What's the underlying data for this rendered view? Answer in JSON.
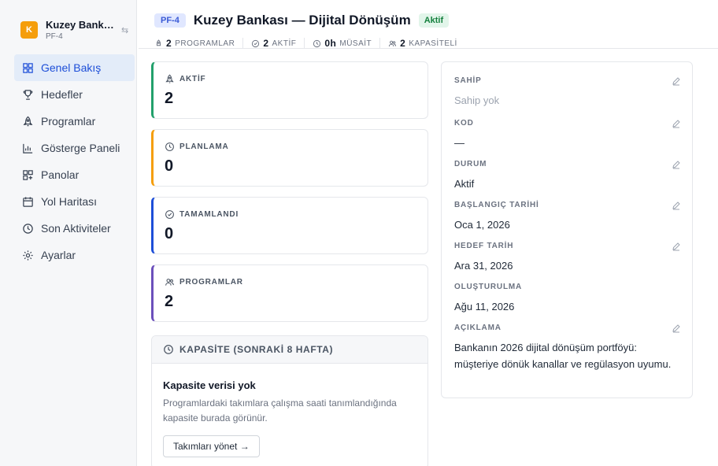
{
  "workspace": {
    "avatar_letter": "K",
    "name": "Kuzey Bankası",
    "key": "PF-4",
    "switch_icon": "⇆"
  },
  "sidebar": {
    "items": [
      {
        "label": "Genel Bakış",
        "icon": "grid-icon",
        "active": true
      },
      {
        "label": "Hedefler",
        "icon": "trophy-icon"
      },
      {
        "label": "Programlar",
        "icon": "rocket-icon"
      },
      {
        "label": "Gösterge Paneli",
        "icon": "bar-chart-icon"
      },
      {
        "label": "Panolar",
        "icon": "board-icon"
      },
      {
        "label": "Yol Haritası",
        "icon": "calendar-icon"
      },
      {
        "label": "Son Aktiviteler",
        "icon": "clock-icon"
      },
      {
        "label": "Ayarlar",
        "icon": "gear-icon"
      }
    ]
  },
  "header": {
    "key": "PF-4",
    "title": "Kuzey Bankası — Dijital Dönüşüm",
    "status": "Aktif",
    "stats": [
      {
        "value": "2",
        "label": "PROGRAMLAR",
        "icon": "rocket-icon"
      },
      {
        "value": "2",
        "label": "AKTİF",
        "icon": "check-circle-icon"
      },
      {
        "value": "0h",
        "label": "MÜSAİT",
        "icon": "clock-icon"
      },
      {
        "value": "2",
        "label": "KAPASİTELİ",
        "icon": "users-icon"
      }
    ]
  },
  "kpis": [
    {
      "label": "AKTİF",
      "value": "2",
      "icon": "rocket-icon",
      "color": "#22a06b"
    },
    {
      "label": "PLANLAMA",
      "value": "0",
      "icon": "clock-icon",
      "color": "#f59e0b"
    },
    {
      "label": "TAMAMLANDI",
      "value": "0",
      "icon": "check-circle-icon",
      "color": "#1d4ed8"
    },
    {
      "label": "PROGRAMLAR",
      "value": "2",
      "icon": "users-icon",
      "color": "#6b4fbb"
    }
  ],
  "capacity": {
    "header": "KAPASİTE (SONRAKİ 8 HAFTA)",
    "empty_title": "Kapasite verisi yok",
    "empty_desc": "Programlardaki takımlara çalışma saati tanımlandığında kapasite burada görünür.",
    "button": "Takımları yönet →"
  },
  "details": {
    "owner": {
      "label": "SAHİP",
      "value": "Sahip yok"
    },
    "code": {
      "label": "KOD",
      "value": "—"
    },
    "status": {
      "label": "DURUM",
      "value": "Aktif"
    },
    "start": {
      "label": "BAŞLANGIÇ TARİHİ",
      "value": "Oca 1, 2026"
    },
    "target": {
      "label": "HEDEF TARİH",
      "value": "Ara 31, 2026"
    },
    "created": {
      "label": "OLUŞTURULMA",
      "value": "Ağu 11, 2026"
    },
    "description": {
      "label": "AÇIKLAMA",
      "value": "Bankanın 2026 dijital dönüşüm portföyü: müşteriye dönük kanallar ve regülasyon uyumu."
    }
  }
}
